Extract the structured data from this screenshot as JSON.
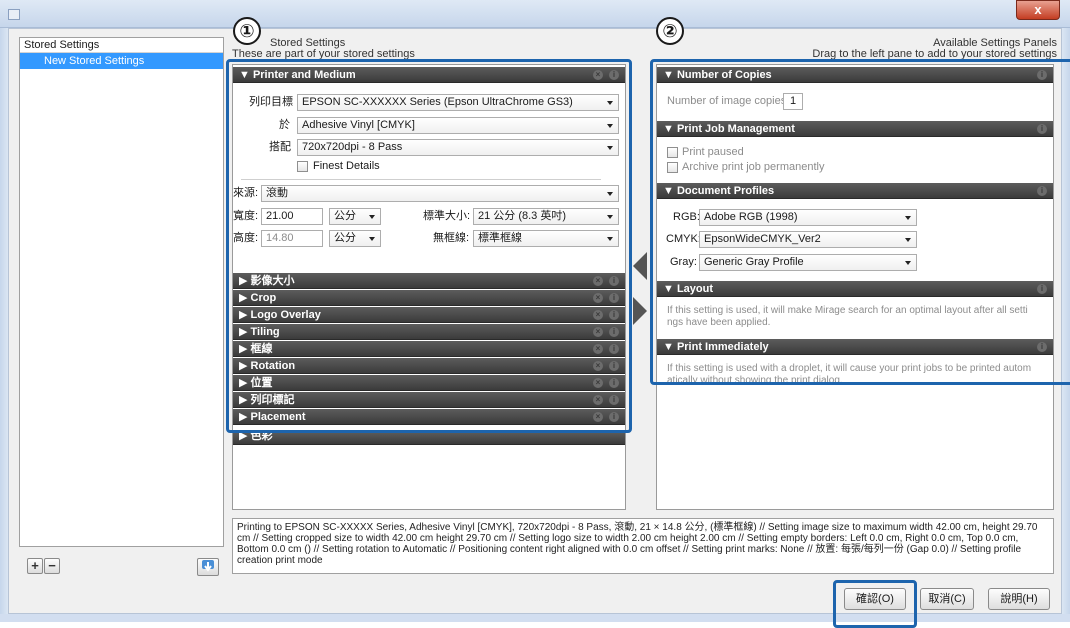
{
  "window": {
    "close_label": "x"
  },
  "stored": {
    "header": "Stored Settings",
    "items": [
      "New Stored Settings"
    ],
    "add_label": "+",
    "remove_label": "−"
  },
  "left_header": {
    "title": "Stored Settings",
    "subtitle": "These are part of your stored settings"
  },
  "right_header": {
    "title": "Available Settings Panels",
    "subtitle": "Drag to the left pane to add to your stored settings"
  },
  "badges": [
    "①",
    "②"
  ],
  "printer_medium": {
    "title": "▼ Printer and Medium",
    "target_label": "列印目標",
    "target_value": "EPSON SC-XXXXXX Series (Epson UltraChrome GS3)",
    "on_label": "於",
    "on_value": "Adhesive Vinyl [CMYK]",
    "config_label": "搭配",
    "config_value": "720x720dpi - 8 Pass",
    "finest_label": "Finest Details",
    "source_label": "來源:",
    "source_value": "滾動",
    "width_label": "寬度:",
    "width_value": "21.00",
    "width_unit": "公分",
    "height_label": "高度:",
    "height_value": "14.80",
    "height_unit": "公分",
    "std_size_label": "標準大小:",
    "std_size_value": "21 公分 (8.3 英吋)",
    "borderless_label": "無框線:",
    "borderless_value": "標準框線"
  },
  "left_sections": [
    "▶ 影像大小",
    "▶ Crop",
    "▶ Logo Overlay",
    "▶ Tiling",
    "▶ 框線",
    "▶ Rotation",
    "▶ 位置",
    "▶ 列印標記",
    "▶ Placement",
    "▶ 色彩"
  ],
  "right": {
    "copies_title": "▼ Number of Copies",
    "copies_label": "Number of image copies:",
    "copies_value": "1",
    "job_title": "▼ Print Job Management",
    "job_paused": "Print paused",
    "job_archive": "Archive print job permanently",
    "profiles_title": "▼ Document Profiles",
    "rgb_label": "RGB:",
    "rgb_value": "Adobe RGB (1998)",
    "cmyk_label": "CMYK:",
    "cmyk_value": "EpsonWideCMYK_Ver2",
    "gray_label": "Gray:",
    "gray_value": "Generic Gray Profile",
    "layout_title": "▼ Layout",
    "layout_text1": "If this setting is used, it will make Mirage search for an optimal layout after all setti",
    "layout_text2": "ngs have been applied.",
    "immediate_title": "▼ Print Immediately",
    "immediate_text1": "If this setting is used with a droplet, it will cause your print jobs to be printed autom",
    "immediate_text2": "atically without showing the print dialog."
  },
  "summary": "Printing to EPSON SC-XXXXX Series, Adhesive Vinyl [CMYK], 720x720dpi - 8 Pass, 滾動, 21 × 14.8 公分, (標準框線) // Setting image size to maximum width 42.00 cm, height 29.70 cm // Setting cropped size to width 42.00 cm height 29.70 cm // Setting logo size to width 2.00 cm height 2.00 cm // Setting empty borders: Left 0.0 cm, Right 0.0 cm, Top 0.0 cm, Bottom 0.0 cm () // Setting rotation to Automatic // Positioning content right aligned with 0.0 cm offset // Setting print marks: None // 放置: 每張/每列一份 (Gap 0.0) // Setting profile creation print mode",
  "buttons": {
    "ok": "確認(O)",
    "cancel": "取消(C)",
    "help": "說明(H)"
  }
}
